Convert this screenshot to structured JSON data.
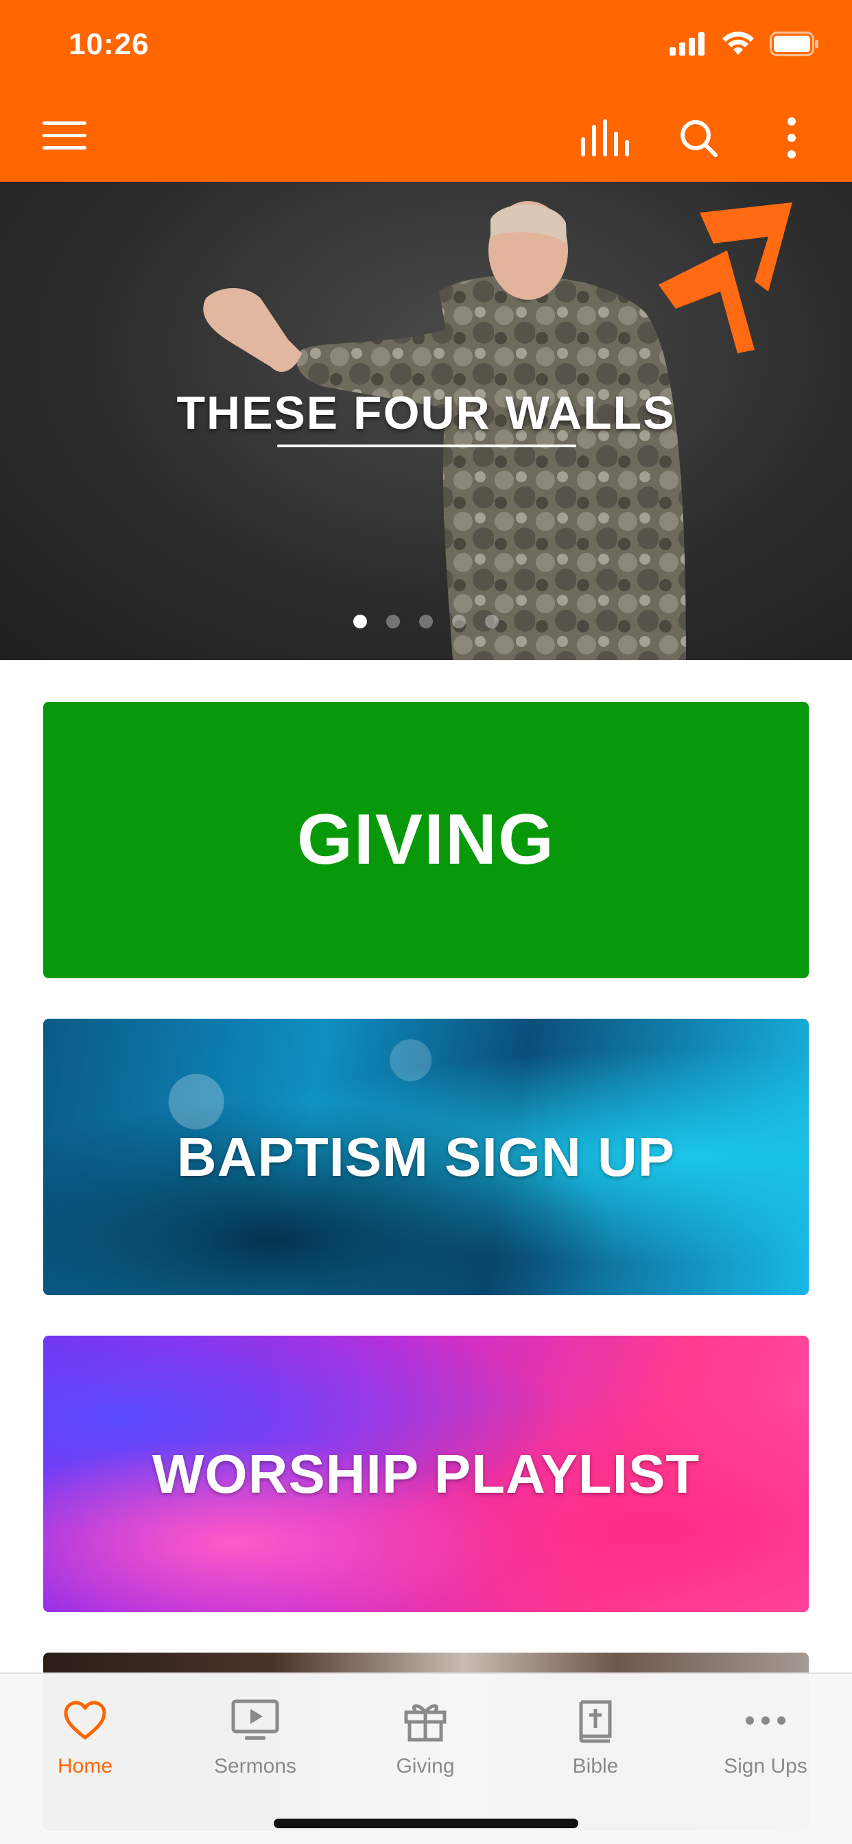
{
  "theme": {
    "accent": "#FF6600",
    "giving_green": "#079909",
    "inactive_gray": "#8a8a8a"
  },
  "status_bar": {
    "time": "10:26",
    "icons": [
      "cellular-signal-icon",
      "wifi-icon",
      "battery-icon"
    ]
  },
  "app_bar": {
    "left_icon": "hamburger-menu-icon",
    "right_icons": [
      "audio-bars-icon",
      "search-icon",
      "more-vertical-icon"
    ]
  },
  "hero": {
    "title": "THESE FOUR WALLS",
    "logo_icon": "arrow-chevron-logo",
    "slide_count": 5,
    "active_slide": 1
  },
  "cards": [
    {
      "label": "GIVING"
    },
    {
      "label": "BAPTISM SIGN UP"
    },
    {
      "label": "WORSHIP PLAYLIST"
    }
  ],
  "tabs": [
    {
      "label": "Home",
      "icon": "heart-icon",
      "active": true
    },
    {
      "label": "Sermons",
      "icon": "tv-play-icon",
      "active": false
    },
    {
      "label": "Giving",
      "icon": "gift-icon",
      "active": false
    },
    {
      "label": "Bible",
      "icon": "bible-icon",
      "active": false
    },
    {
      "label": "Sign Ups",
      "icon": "more-horizontal-icon",
      "active": false
    }
  ]
}
